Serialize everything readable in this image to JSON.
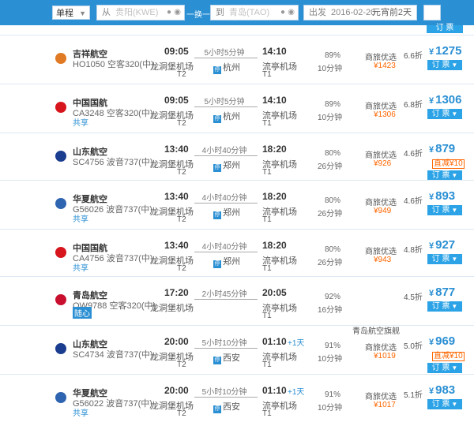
{
  "search": {
    "trip_type": "单程",
    "from_prefix": "从",
    "from_value": "贵阳(KWE)",
    "swap_label": "一换一",
    "to_prefix": "到",
    "to_value": "青岛(TAO)",
    "date_prefix": "出发",
    "date_value": "2016-02-20",
    "date_hint": "元宵前2天"
  },
  "top_book_label": "订 票",
  "flights": [
    {
      "airline": "吉祥航空",
      "flight_no": "HO1050",
      "aircraft": "空客320(中)",
      "share": "",
      "dep_time": "09:05",
      "dep_airport": "龙洞堡机场",
      "dep_term": "T2",
      "duration": "5小时5分钟",
      "stop": "杭州",
      "arr_time": "14:10",
      "plus": "",
      "arr_airport": "流亭机场",
      "arr_term": "T1",
      "ontime": "89%",
      "delay": "10分钟",
      "cabin": "商旅优选",
      "tax": "¥1423",
      "discount": "6.6折",
      "price": "1275",
      "reduce": "",
      "book": "订 票",
      "logo": "#e07a24"
    },
    {
      "airline": "中国国航",
      "flight_no": "CA3248",
      "aircraft": "空客320(中)",
      "share": "共享",
      "dep_time": "09:05",
      "dep_airport": "龙洞堡机场",
      "dep_term": "T2",
      "duration": "5小时5分钟",
      "stop": "杭州",
      "arr_time": "14:10",
      "plus": "",
      "arr_airport": "流亭机场",
      "arr_term": "T1",
      "ontime": "89%",
      "delay": "10分钟",
      "cabin": "商旅优选",
      "tax": "¥1306",
      "discount": "6.8折",
      "price": "1306",
      "reduce": "",
      "book": "订 票",
      "logo": "#d7151d"
    },
    {
      "airline": "山东航空",
      "flight_no": "SC4756",
      "aircraft": "波音737(中)",
      "share": "",
      "dep_time": "13:40",
      "dep_airport": "龙洞堡机场",
      "dep_term": "T2",
      "duration": "4小时40分钟",
      "stop": "郑州",
      "arr_time": "18:20",
      "plus": "",
      "arr_airport": "流亭机场",
      "arr_term": "T1",
      "ontime": "80%",
      "delay": "26分钟",
      "cabin": "商旅优选",
      "tax": "¥926",
      "discount": "4.6折",
      "price": "879",
      "reduce": "直减¥10",
      "book": "订 票",
      "logo": "#1b3d8f"
    },
    {
      "airline": "华夏航空",
      "flight_no": "G56026",
      "aircraft": "波音737(中)",
      "share": "共享",
      "dep_time": "13:40",
      "dep_airport": "龙洞堡机场",
      "dep_term": "T2",
      "duration": "4小时40分钟",
      "stop": "郑州",
      "arr_time": "18:20",
      "plus": "",
      "arr_airport": "流亭机场",
      "arr_term": "T1",
      "ontime": "80%",
      "delay": "26分钟",
      "cabin": "商旅优选",
      "tax": "¥949",
      "discount": "4.6折",
      "price": "893",
      "reduce": "",
      "book": "订 票",
      "logo": "#2f64b0"
    },
    {
      "airline": "中国国航",
      "flight_no": "CA4756",
      "aircraft": "波音737(中)",
      "share": "共享",
      "dep_time": "13:40",
      "dep_airport": "龙洞堡机场",
      "dep_term": "T2",
      "duration": "4小时40分钟",
      "stop": "郑州",
      "arr_time": "18:20",
      "plus": "",
      "arr_airport": "流亭机场",
      "arr_term": "T1",
      "ontime": "80%",
      "delay": "26分钟",
      "cabin": "商旅优选",
      "tax": "¥943",
      "discount": "4.8折",
      "price": "927",
      "reduce": "",
      "book": "订 票",
      "logo": "#d7151d"
    },
    {
      "airline": "青岛航空",
      "flight_no": "QW9788",
      "aircraft": "空客320(中)",
      "share": "随心",
      "dep_time": "17:20",
      "dep_airport": "龙洞堡机场",
      "dep_term": "",
      "duration": "2小时45分钟",
      "stop": "",
      "arr_time": "20:05",
      "plus": "",
      "arr_airport": "流亭机场",
      "arr_term": "T1",
      "ontime": "92%",
      "delay": "16分钟",
      "cabin": "",
      "tax": "",
      "discount": "4.5折",
      "price": "877",
      "reduce": "",
      "book": "订 票",
      "logo": "#c8102e"
    },
    {
      "airline": "山东航空",
      "flight_no": "SC4734",
      "aircraft": "波音737(中)",
      "share": "",
      "dep_time": "20:00",
      "dep_airport": "龙洞堡机场",
      "dep_term": "T2",
      "duration": "5小时10分钟",
      "stop": "西安",
      "arr_time": "01:10",
      "plus": "+1天",
      "arr_airport": "流亭机场",
      "arr_term": "T1",
      "ontime": "91%",
      "delay": "10分钟",
      "cabin": "商旅优选",
      "tax": "¥1019",
      "discount": "5.0折",
      "price": "969",
      "reduce": "直减¥10",
      "book": "订 票",
      "logo": "#1b3d8f",
      "flag": "青岛航空旗舰"
    },
    {
      "airline": "华夏航空",
      "flight_no": "G56022",
      "aircraft": "波音737(中)",
      "share": "共享",
      "dep_time": "20:00",
      "dep_airport": "龙洞堡机场",
      "dep_term": "T2",
      "duration": "5小时10分钟",
      "stop": "西安",
      "arr_time": "01:10",
      "plus": "+1天",
      "arr_airport": "流亭机场",
      "arr_term": "T1",
      "ontime": "91%",
      "delay": "10分钟",
      "cabin": "商旅优选",
      "tax": "¥1017",
      "discount": "5.1折",
      "price": "983",
      "reduce": "",
      "book": "订 票",
      "logo": "#2f64b0"
    }
  ]
}
